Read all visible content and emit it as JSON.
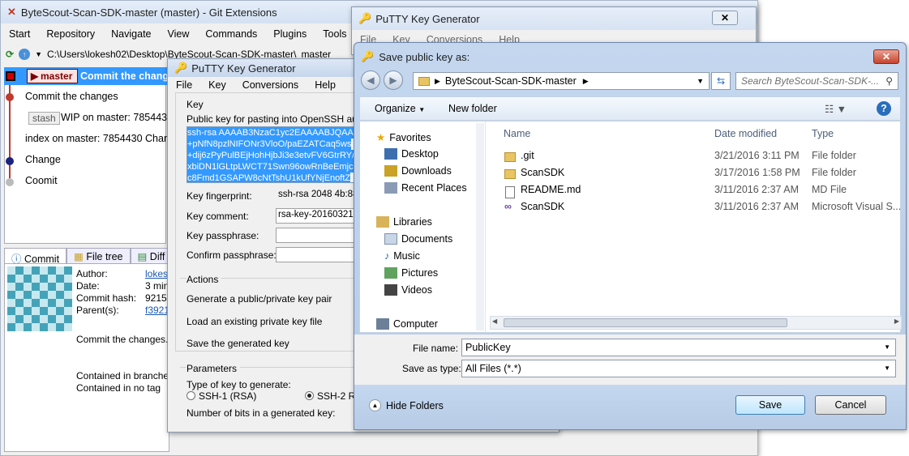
{
  "git_extensions": {
    "title": "ByteScout-Scan-SDK-master (master) - Git Extensions",
    "menu": [
      "Start",
      "Repository",
      "Navigate",
      "View",
      "Commands",
      "Plugins",
      "Tools"
    ],
    "path": "C:\\Users\\lokesh02\\Desktop\\ByteScout-Scan-SDK-master\\",
    "path_branch": "master",
    "branch_label": "master",
    "selected_message": "Commit the change",
    "graph_rows": [
      "Commit the changes",
      "stash",
      "WIP on master: 7854430 C",
      "index on master: 7854430 Change",
      "Change",
      "Coomit"
    ],
    "tabs": [
      "Commit",
      "File tree",
      "Diff"
    ],
    "commit_info": {
      "author_label": "Author:",
      "author_value": "lokes",
      "date_label": "Date:",
      "date_value": "3 min",
      "hash_label": "Commit hash:",
      "hash_value": "92154",
      "parents_label": "Parent(s):",
      "parents_value": "f3921",
      "message": "Commit the changes.",
      "contained_branches": "Contained in branche",
      "contained_tags": "Contained in no tag"
    }
  },
  "putty_back": {
    "title": "PuTTY Key Generator",
    "menu": [
      "File",
      "Key",
      "Conversions",
      "Help"
    ]
  },
  "putty": {
    "title": "PuTTY Key Generator",
    "menu": [
      "File",
      "Key",
      "Conversions",
      "Help"
    ],
    "key_group": "Key",
    "pubkey_label": "Public key for pasting into OpenSSH autho",
    "pubkey_lines": [
      "ssh-rsa AAAAB3NzaC1yc2EAAAABJQAAA",
      "+pNfN8pzlNIFONr3VloO/paEZATCaq5ws",
      "+dij6zPyPulBEjHohHjbJi3e3etvFV6GtrRY/",
      "xbiDN1lGLtpLWCT71Swn96owRnBeEmjc",
      "c8Fmd1GSAPW8cNtTshU1kUfYNjEnoftZ"
    ],
    "fingerprint_label": "Key fingerprint:",
    "fingerprint_value": "ssh-rsa 2048 4b:88",
    "comment_label": "Key comment:",
    "comment_value": "rsa-key-20160321",
    "passphrase_label": "Key passphrase:",
    "confirm_label": "Confirm passphrase:",
    "actions_group": "Actions",
    "action_generate": "Generate a public/private key pair",
    "action_load": "Load an existing private key file",
    "action_save": "Save the generated key",
    "params_group": "Parameters",
    "type_label": "Type of key to generate:",
    "ssh1": "SSH-1 (RSA)",
    "ssh2": "SSH-2 R",
    "bits_label": "Number of bits in a generated key:"
  },
  "save_dialog": {
    "title": "Save public key as:",
    "breadcrumb": "ByteScout-Scan-SDK-master",
    "search_placeholder": "Search ByteScout-Scan-SDK-...",
    "organize": "Organize",
    "new_folder": "New folder",
    "nav": {
      "favorites": "Favorites",
      "desktop": "Desktop",
      "downloads": "Downloads",
      "recent": "Recent Places",
      "libraries": "Libraries",
      "documents": "Documents",
      "music": "Music",
      "pictures": "Pictures",
      "videos": "Videos",
      "computer": "Computer"
    },
    "columns": {
      "name": "Name",
      "date": "Date modified",
      "type": "Type"
    },
    "files": [
      {
        "name": ".git",
        "date": "3/21/2016 3:11 PM",
        "type": "File folder",
        "icon": "folder-icon"
      },
      {
        "name": "ScanSDK",
        "date": "3/17/2016 1:58 PM",
        "type": "File folder",
        "icon": "folder-icon"
      },
      {
        "name": "README.md",
        "date": "3/11/2016 2:37 AM",
        "type": "MD File",
        "icon": "document-icon"
      },
      {
        "name": "ScanSDK",
        "date": "3/11/2016 2:37 AM",
        "type": "Microsoft Visual S...",
        "icon": "visual-studio-icon"
      }
    ],
    "filename_label": "File name:",
    "filename_value": "PublicKey",
    "savetype_label": "Save as type:",
    "savetype_value": "All Files (*.*)",
    "hide_folders": "Hide Folders",
    "save_button": "Save",
    "cancel_button": "Cancel"
  }
}
